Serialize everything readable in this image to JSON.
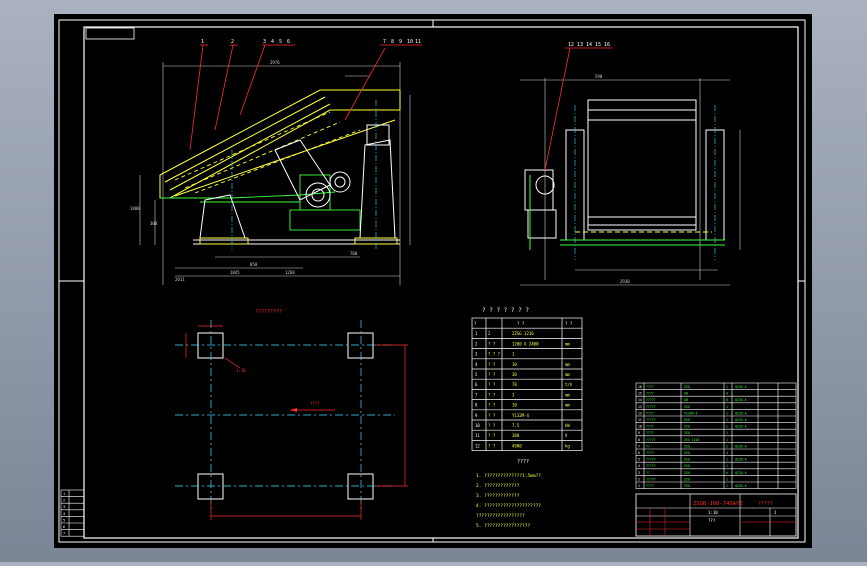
{
  "drawing": {
    "title": "7?????",
    "parts_balloons_left": [
      "1",
      "2",
      "3",
      "4",
      "5",
      "6",
      "7",
      "8",
      "9",
      "10",
      "11"
    ],
    "parts_balloons_right": [
      "12",
      "13",
      "14",
      "15",
      "16"
    ],
    "foundation_label": "?????????",
    "foundation_note": "1:10",
    "foundation_arrow_label": "????",
    "dim_labels": [
      "2976",
      "1045",
      "1260",
      "2011",
      "850",
      "700",
      "1800",
      "300",
      "590",
      "2930"
    ],
    "spec_table": {
      "title": "? ? ? ? ? ? ?",
      "header": [
        "?",
        "?  ?",
        "?  ?"
      ],
      "rows": [
        [
          "1",
          "2",
          "2ZSG 1216"
        ],
        [
          "2",
          "?  ?",
          "1200 X 2400",
          "mm"
        ],
        [
          "3",
          "?  ?  ?",
          "1"
        ],
        [
          "4",
          "? ?",
          "10",
          "mm"
        ],
        [
          "5",
          "? ?",
          "30",
          "mm"
        ],
        [
          "6",
          "? ?",
          "70",
          "t/h"
        ],
        [
          "7",
          "? ?",
          "3",
          "mm"
        ],
        [
          "8",
          "? ?",
          "10",
          "mm"
        ],
        [
          "9",
          "? ?",
          "Y132M-4",
          ""
        ],
        [
          "10",
          "? ?",
          "7.5",
          "kW"
        ],
        [
          "11",
          "? ?",
          "380",
          "V"
        ],
        [
          "12",
          "? ?",
          "4900",
          "kg"
        ]
      ]
    },
    "notes_title": "????",
    "notes": [
      "1. ??????????????1:5mm??",
      "2. ?????????????",
      "3. ?????????????",
      "4. ?????????????????????",
      "   ??????????????????",
      "5. ?????????????????"
    ],
    "title_block": {
      "drawing_no": "ZSGB-100-740AYZ",
      "part_name": "?????",
      "scale": "1:10",
      "sheet": "1",
      "company": "???"
    },
    "bom_rows": [
      [
        "16",
        "????",
        "ZSG",
        "1",
        "Q235-A"
      ],
      [
        "15",
        "????",
        "GB",
        "4",
        ""
      ],
      [
        "14",
        "?????",
        "GB",
        "8",
        "Q235-A"
      ],
      [
        "13",
        "?????",
        "ZSG",
        "1",
        ""
      ],
      [
        "12",
        "????",
        "Y132M-4",
        "1",
        "Q235-A"
      ],
      [
        "11",
        "?????",
        "ZSG",
        "1",
        "Q235-A"
      ],
      [
        "10",
        "????",
        "ZSG",
        "2",
        "Q235-A"
      ],
      [
        "9",
        "????",
        "ZSG",
        "1",
        ""
      ],
      [
        "8",
        "?????",
        "ZSG 1216",
        "1",
        ""
      ],
      [
        "7",
        "??",
        "ZSG",
        "2",
        "Q235-A"
      ],
      [
        "6",
        "????",
        "ZSG",
        "4",
        ""
      ],
      [
        "5",
        "?????",
        "ZSG",
        "1",
        "Q235-A"
      ],
      [
        "4",
        "?????",
        "ZSG",
        "1",
        ""
      ],
      [
        "3",
        "??",
        "ZSG",
        "6",
        "Q235-A"
      ],
      [
        "2",
        "?????",
        "ZSG",
        "1",
        ""
      ],
      [
        "1",
        "????",
        "ZSG",
        "1",
        "Q235-A"
      ]
    ],
    "revision_rows": [
      "1",
      "2",
      "3",
      "4",
      "5",
      "6",
      "7"
    ]
  },
  "colors": {
    "background": "#000000",
    "frame": "#ffffff",
    "red": "#ff2a2a",
    "yellow": "#ffff3a",
    "green": "#3aff3a",
    "cyan": "#39e0ff",
    "white": "#ffffff"
  }
}
